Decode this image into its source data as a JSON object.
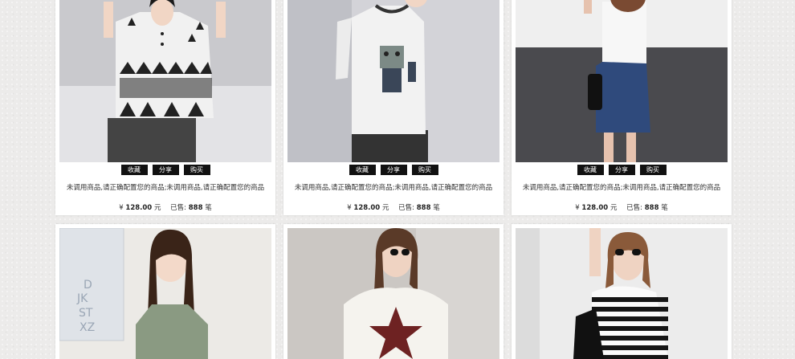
{
  "actions": {
    "collect": "收藏",
    "share": "分享",
    "buy": "购买"
  },
  "products": [
    {
      "desc": "未调用商品,请正确配置您的商品;未调用商品,请正确配置您的商品",
      "currency": "¥",
      "price": "128.00",
      "price_unit": "元",
      "sold_label": "已售:",
      "sold": "888",
      "sold_unit": "笔",
      "image": "model-geometric-print-top"
    },
    {
      "desc": "未调用商品,请正确配置您的商品;未调用商品,请正确配置您的商品",
      "currency": "¥",
      "price": "128.00",
      "price_unit": "元",
      "sold_label": "已售:",
      "sold": "888",
      "sold_unit": "笔",
      "image": "model-cat-print-tee"
    },
    {
      "desc": "未调用商品,请正确配置您的商品;未调用商品,请正确配置您的商品",
      "currency": "¥",
      "price": "128.00",
      "price_unit": "元",
      "sold_label": "已售:",
      "sold": "888",
      "sold_unit": "笔",
      "image": "model-white-tee-denim-skirt"
    },
    {
      "image": "model-olive-tee"
    },
    {
      "image": "model-star-print-top"
    },
    {
      "image": "model-striped-top-sunglasses"
    }
  ],
  "colors": {
    "page_bg": "#ecebea",
    "card_bg": "#ffffff",
    "button_bg": "#111111",
    "button_text": "#ffffff"
  }
}
